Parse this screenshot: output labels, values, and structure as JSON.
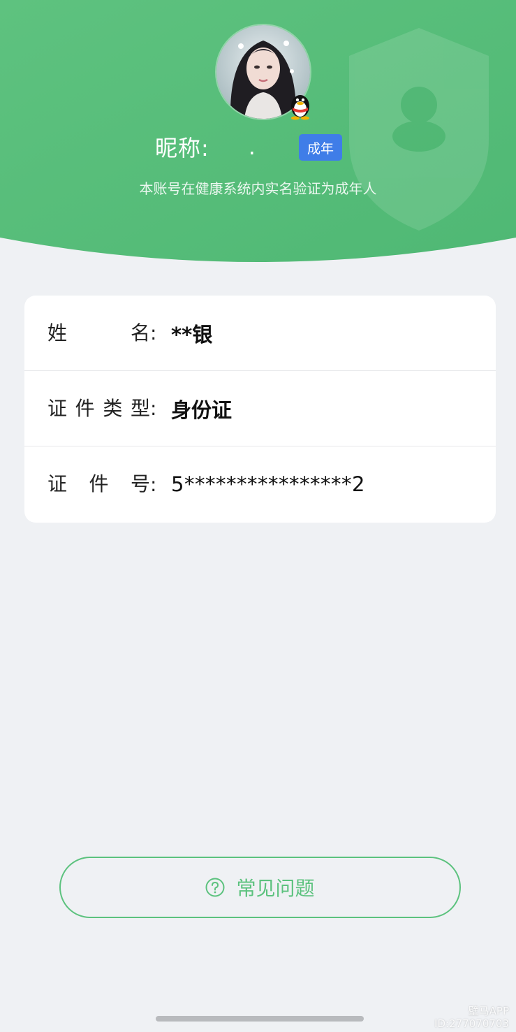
{
  "profile": {
    "nickname_label": "昵称:",
    "nickname_value": ".",
    "age_tag": "成年",
    "verify_note": "本账号在健康系统内实名验证为成年人"
  },
  "identity": {
    "rows": [
      {
        "label": "姓名",
        "colon": ":",
        "value": "**银"
      },
      {
        "label": "证件类型",
        "colon": ":",
        "value": "身份证"
      },
      {
        "label": "证件号",
        "colon": ":",
        "value": "5****************2"
      }
    ]
  },
  "faq": {
    "label": "常见问题"
  },
  "watermark": {
    "line1": "壁马APP",
    "line2": "ID:277070703"
  },
  "colors": {
    "header_green": "#5cc27e",
    "tag_blue": "#3f7de8",
    "page_bg": "#eff1f4"
  },
  "icons": {
    "avatar": "avatar-photo",
    "qq_badge": "qq-penguin-icon",
    "shield": "shield-icon",
    "faq": "question-circle-icon"
  }
}
